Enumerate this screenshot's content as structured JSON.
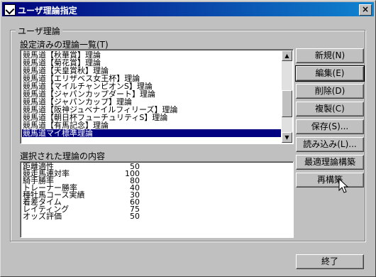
{
  "window": {
    "title": "ユーザ理論指定",
    "close_label": "×"
  },
  "group": {
    "label": "ユーザ理論"
  },
  "theory_list": {
    "label": "設定済みの理論一覧(T)",
    "items": [
      "競馬道【秋華賞】理論",
      "競馬道【菊花賞】理論",
      "競馬道【天皇賞秋】理論",
      "競馬道【エリザベス女王杯】理論",
      "競馬道【マイルチャンピオンS】理論",
      "競馬道【ジャパンカップダート】理論",
      "競馬道【ジャパンカップ】理論",
      "競馬道【阪神ジュベナイルフィリーズ】理論",
      "競馬道【朝日杯フューチュリティS】理論",
      "競馬道【有馬記念】理論",
      "競馬道マイ標準理論"
    ],
    "selected_index": 10,
    "scroll_up_icon": "▲",
    "scroll_down_icon": "▼"
  },
  "content_list": {
    "label": "選択された理論の内容",
    "rows": [
      {
        "name": "距離適性",
        "value": "50"
      },
      {
        "name": "競走馬連対率",
        "value": "100"
      },
      {
        "name": "騎手勝率",
        "value": "80"
      },
      {
        "name": "トレーナー勝率",
        "value": "40"
      },
      {
        "name": "種牡馬コース実績",
        "value": "30"
      },
      {
        "name": "着差タイム",
        "value": "60"
      },
      {
        "name": "レイティング",
        "value": "75"
      },
      {
        "name": "オッズ評価",
        "value": "50"
      }
    ]
  },
  "buttons": {
    "new": "新規(N)",
    "edit": "編集(E)",
    "delete": "削除(D)",
    "copy": "複製(C)",
    "save": "保存(S)...",
    "load": "読み込み(L)...",
    "optimize": "最適理論構築",
    "rebuild": "再構築",
    "exit": "終了"
  },
  "cursor_icon": "arrow-cursor"
}
